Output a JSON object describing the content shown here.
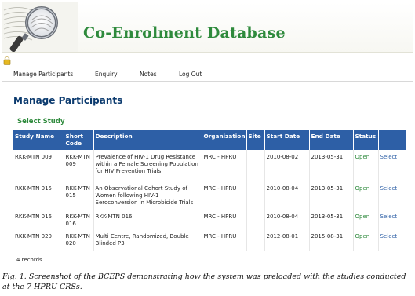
{
  "header": {
    "app_title": "Co-Enrolment Database",
    "logo_icon": "magnifying-glass-fingerprint-icon"
  },
  "status_icon": "lock-icon",
  "nav": {
    "items": [
      "Manage Participants",
      "Enquiry",
      "Notes",
      "Log Out"
    ]
  },
  "page_title": "Manage Participants",
  "section_title": "Select Study",
  "table": {
    "headers": [
      "Study Name",
      "Short Code",
      "Description",
      "Organization",
      "Site",
      "Start Date",
      "End Date",
      "Status",
      ""
    ],
    "rows": [
      {
        "study_name": "RKK-MTN 009",
        "short_code": "RKK-MTN 009",
        "description": "Prevalence of HIV-1 Drug Resistance within a Female Screening Population for HIV Prevention Trials",
        "organization": "MRC - HPRU",
        "site": "",
        "start_date": "2010-08-02",
        "end_date": "2013-05-31",
        "status": "Open",
        "action": "Select"
      },
      {
        "study_name": "RKK-MTN 015",
        "short_code": "RKK-MTN 015",
        "description": "An Observational Cohort Study of Women following HIV-1 Seroconversion in Microbicide Trials",
        "organization": "MRC - HPRU",
        "site": "",
        "start_date": "2010-08-04",
        "end_date": "2013-05-31",
        "status": "Open",
        "action": "Select"
      },
      {
        "study_name": "RKK-MTN 016",
        "short_code": "RKK-MTN 016",
        "description": "RKK-MTN 016",
        "organization": "MRC - HPRU",
        "site": "",
        "start_date": "2010-08-04",
        "end_date": "2013-05-31",
        "status": "Open",
        "action": "Select"
      },
      {
        "study_name": "RKK-MTN 020",
        "short_code": "RKK-MTN 020",
        "description": "Multi Centre, Randomized, Bouble Blinded P3",
        "organization": "MRC - HPRU",
        "site": "",
        "start_date": "2012-08-01",
        "end_date": "2015-08-31",
        "status": "Open",
        "action": "Select"
      }
    ]
  },
  "records_text": "4 records",
  "caption": "Fig. 1. Screenshot of the BCEPS demonstrating how the system was preloaded with the studies conducted at the 7 HPRU CRSs.",
  "colors": {
    "brand_green": "#2e8a3c",
    "header_blue": "#2d5fa6",
    "title_navy": "#0b3a6e"
  }
}
